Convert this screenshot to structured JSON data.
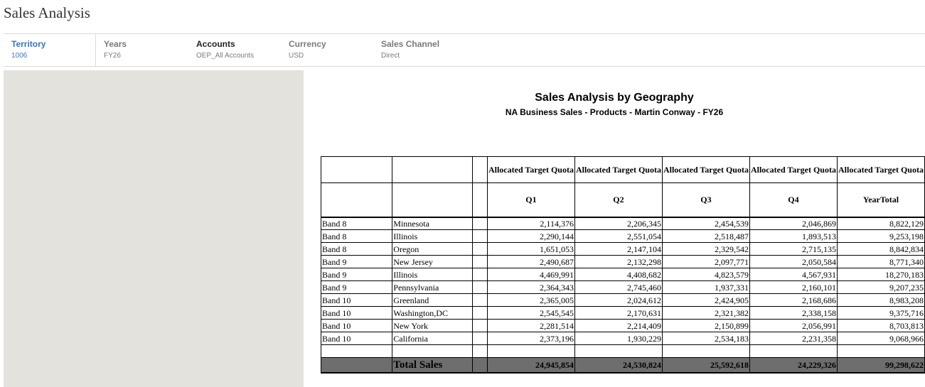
{
  "page_title": "Sales Analysis",
  "pov": [
    {
      "label": "Territory",
      "value": "1006"
    },
    {
      "label": "Years",
      "value": "FY26"
    },
    {
      "label": "Accounts",
      "value": "OEP_All Accounts"
    },
    {
      "label": "Currency",
      "value": "USD"
    },
    {
      "label": "Sales Channel",
      "value": "Direct"
    }
  ],
  "report": {
    "title": "Sales Analysis by Geography",
    "subtitle": "NA Business Sales - Products - Martin Conway - FY26",
    "col_header_1": "Allocated Target Quota",
    "col_header_2": [
      "Q1",
      "Q2",
      "Q3",
      "Q4",
      "YearTotal"
    ],
    "rows": [
      {
        "band": "Band 8",
        "state": "Minnesota",
        "vals": [
          "2,114,376",
          "2,206,345",
          "2,454,539",
          "2,046,869",
          "8,822,129"
        ]
      },
      {
        "band": "Band 8",
        "state": "Illinois",
        "vals": [
          "2,290,144",
          "2,551,054",
          "2,518,487",
          "1,893,513",
          "9,253,198"
        ]
      },
      {
        "band": "Band 8",
        "state": "Oregon",
        "vals": [
          "1,651,053",
          "2,147,104",
          "2,329,542",
          "2,715,135",
          "8,842,834"
        ]
      },
      {
        "band": "Band 9",
        "state": "New Jersey",
        "vals": [
          "2,490,687",
          "2,132,298",
          "2,097,771",
          "2,050,584",
          "8,771,340"
        ]
      },
      {
        "band": "Band 9",
        "state": "Illinois",
        "vals": [
          "4,469,991",
          "4,408,682",
          "4,823,579",
          "4,567,931",
          "18,270,183"
        ]
      },
      {
        "band": "Band 9",
        "state": "Pennsylvania",
        "vals": [
          "2,364,343",
          "2,745,460",
          "1,937,331",
          "2,160,101",
          "9,207,235"
        ]
      },
      {
        "band": "Band 10",
        "state": "Greenland",
        "vals": [
          "2,365,005",
          "2,024,612",
          "2,424,905",
          "2,168,686",
          "8,983,208"
        ]
      },
      {
        "band": "Band 10",
        "state": "Washington,DC",
        "vals": [
          "2,545,545",
          "2,170,631",
          "2,321,382",
          "2,338,158",
          "9,375,716"
        ]
      },
      {
        "band": "Band 10",
        "state": "New York",
        "vals": [
          "2,281,514",
          "2,214,409",
          "2,150,899",
          "2,056,991",
          "8,703,813"
        ]
      },
      {
        "band": "Band 10",
        "state": "California",
        "vals": [
          "2,373,196",
          "1,930,229",
          "2,534,183",
          "2,231,358",
          "9,068,966"
        ]
      }
    ],
    "total_label": "Total Sales",
    "totals": [
      "24,945,854",
      "24,530,824",
      "25,592,618",
      "24,229,326",
      "99,298,622"
    ]
  }
}
